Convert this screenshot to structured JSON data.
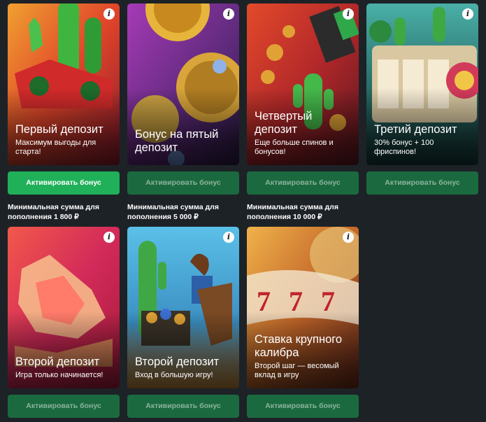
{
  "cards": [
    {
      "title": "Первый депозит",
      "subtitle": "Максимум выгоды для старта!",
      "button": "Активировать бонус",
      "info_icon": "info-icon"
    },
    {
      "title": "Бонус на пятый депозит",
      "subtitle": "",
      "button": "Активировать бонус",
      "info_icon": "info-icon"
    },
    {
      "title": "Четвертый депозит",
      "subtitle": "Еще больше спинов и бонусов!",
      "button": "Активировать бонус",
      "info_icon": "info-icon"
    },
    {
      "title": "Третий депозит",
      "subtitle": "30% бонус + 100 фриспинов!",
      "button": "Активировать бонус",
      "info_icon": "info-icon"
    },
    {
      "title": "Второй депозит",
      "subtitle": "Игра только начинается!",
      "button": "Активировать бонус",
      "info_icon": "info-icon"
    },
    {
      "title": "Второй депозит",
      "subtitle": "Вход в большую игру!",
      "button": "Активировать бонус",
      "info_icon": "info-icon"
    },
    {
      "title": "Ставка крупного калибра",
      "subtitle": "Второй шаг — весомый вклад в игру",
      "button": "Активировать бонус",
      "info_icon": "info-icon"
    }
  ],
  "min_deposits": [
    "Минимальная сумма для пополнения 1 800 ₽",
    "Минимальная сумма для пополнения 5 000 ₽",
    "Минимальная сумма для пополнения 10 000 ₽"
  ],
  "colors": {
    "background": "#1d2227",
    "button_active": "#20b05a",
    "button_muted": "#1b6a3f",
    "button_muted_text": "#8bb49c"
  }
}
